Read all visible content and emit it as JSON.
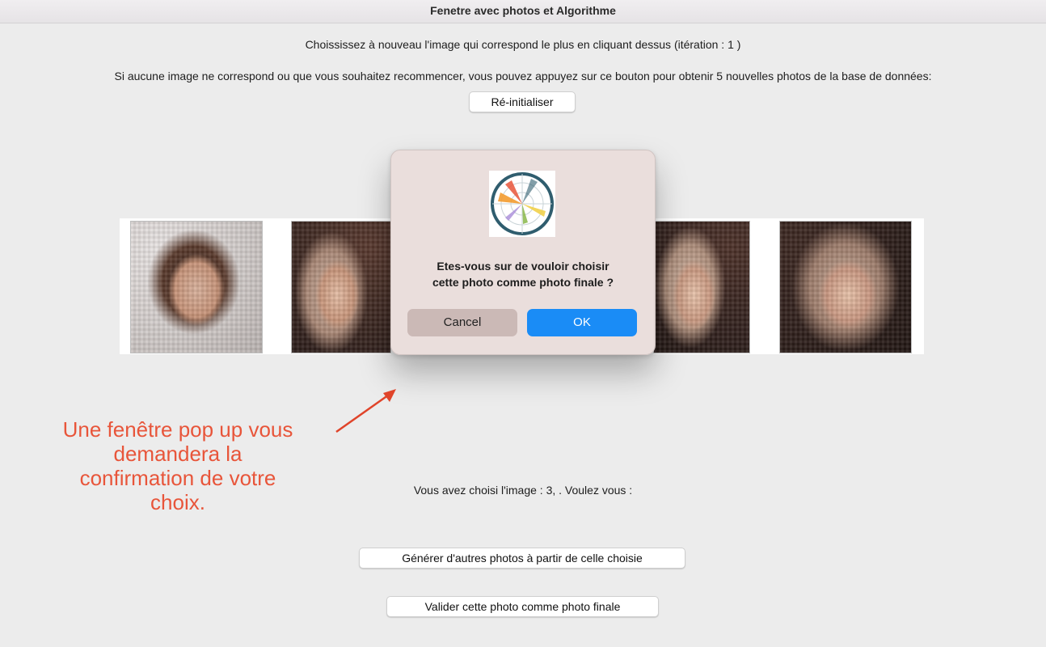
{
  "window": {
    "title": "Fenetre avec photos et  Algorithme"
  },
  "instructions": {
    "line1": "Choississez à nouveau l'image qui correspond le plus en cliquant dessus (itération : 1 )",
    "line2": "Si aucune image ne correspond ou que vous souhaitez recommencer, vous pouvez appuyez sur ce bouton pour obtenir 5 nouvelles photos de la base de données:"
  },
  "reset_button": {
    "label": "Ré-initialiser"
  },
  "photos": [
    {
      "id": "photo-1"
    },
    {
      "id": "photo-2"
    },
    {
      "id": "photo-3"
    },
    {
      "id": "photo-4"
    },
    {
      "id": "photo-5"
    }
  ],
  "dialog": {
    "icon": "polar-chart-app-icon",
    "message_line1": "Etes-vous sur de vouloir choisir",
    "message_line2": "cette photo comme photo finale ?",
    "cancel_label": "Cancel",
    "ok_label": "OK"
  },
  "selection": {
    "text": "Vous avez choisi l'image : 3, . Voulez vous :"
  },
  "actions": {
    "generate_label": "Générer d'autres photos à partir de celle choisie",
    "validate_label": "Valider cette photo comme photo finale"
  },
  "annotation": {
    "line1": "Une fenêtre pop up vous",
    "line2": "demandera la",
    "line3": "confirmation de votre",
    "line4": "choix.",
    "color": "#e8553a"
  },
  "colors": {
    "background": "#ececec",
    "ok_button": "#1a8cf6",
    "cancel_button": "#cbb9b6"
  }
}
